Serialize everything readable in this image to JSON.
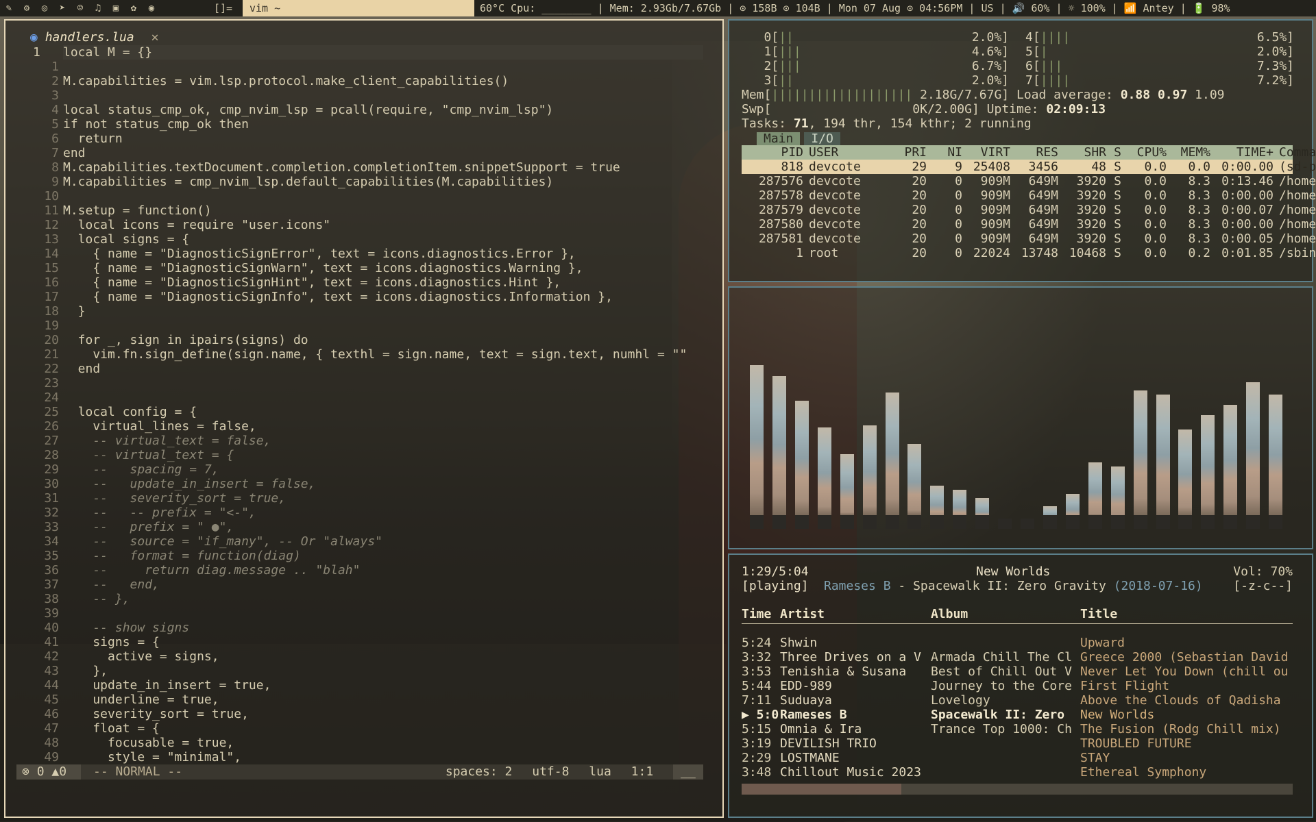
{
  "topbar": {
    "icons": [
      "paperclip-icon",
      "settings-icon",
      "browser-icon",
      "telegram-icon",
      "discord-icon",
      "music-icon",
      "screen-icon",
      "spotify-icon",
      "gamepad-icon"
    ],
    "layout": "[]=",
    "title": "vim ~",
    "status": "60°C Cpu: ________  |  Mem: 2.93Gb/7.67Gb  |  ⊙ 158B  ⊙ 104B  |  Mon 07 Aug  ⊙ 04:56PM  |  US  |  🔊 60%  |  ☼ 100%  |  📶 Antey  |  🔋 98%"
  },
  "vim": {
    "tab_name": "handlers.lua",
    "lines": [
      {
        "n": "1",
        "t": "local M = {}",
        "cur": true
      },
      {
        "n": "1",
        "t": ""
      },
      {
        "n": "2",
        "t": "M.capabilities = vim.lsp.protocol.make_client_capabilities()"
      },
      {
        "n": "3",
        "t": ""
      },
      {
        "n": "4",
        "t": "local status_cmp_ok, cmp_nvim_lsp = pcall(require, \"cmp_nvim_lsp\")"
      },
      {
        "n": "5",
        "t": "if not status_cmp_ok then"
      },
      {
        "n": "6",
        "t": "  return"
      },
      {
        "n": "7",
        "t": "end"
      },
      {
        "n": "8",
        "t": "M.capabilities.textDocument.completion.completionItem.snippetSupport = true"
      },
      {
        "n": "9",
        "t": "M.capabilities = cmp_nvim_lsp.default_capabilities(M.capabilities)"
      },
      {
        "n": "10",
        "t": ""
      },
      {
        "n": "11",
        "t": "M.setup = function()"
      },
      {
        "n": "12",
        "t": "  local icons = require \"user.icons\""
      },
      {
        "n": "13",
        "t": "  local signs = {"
      },
      {
        "n": "14",
        "t": "    { name = \"DiagnosticSignError\", text = icons.diagnostics.Error },"
      },
      {
        "n": "15",
        "t": "    { name = \"DiagnosticSignWarn\", text = icons.diagnostics.Warning },"
      },
      {
        "n": "16",
        "t": "    { name = \"DiagnosticSignHint\", text = icons.diagnostics.Hint },"
      },
      {
        "n": "17",
        "t": "    { name = \"DiagnosticSignInfo\", text = icons.diagnostics.Information },"
      },
      {
        "n": "18",
        "t": "  }"
      },
      {
        "n": "19",
        "t": ""
      },
      {
        "n": "20",
        "t": "  for _, sign in ipairs(signs) do"
      },
      {
        "n": "21",
        "t": "    vim.fn.sign_define(sign.name, { texthl = sign.name, text = sign.text, numhl = \"\""
      },
      {
        "n": "22",
        "t": "  end"
      },
      {
        "n": "23",
        "t": ""
      },
      {
        "n": "24",
        "t": ""
      },
      {
        "n": "25",
        "t": "  local config = {"
      },
      {
        "n": "26",
        "t": "    virtual_lines = false,"
      },
      {
        "n": "27",
        "t": "    -- virtual_text = false,"
      },
      {
        "n": "28",
        "t": "    -- virtual_text = {"
      },
      {
        "n": "29",
        "t": "    --   spacing = 7,"
      },
      {
        "n": "30",
        "t": "    --   update_in_insert = false,"
      },
      {
        "n": "31",
        "t": "    --   severity_sort = true,"
      },
      {
        "n": "32",
        "t": "    --   -- prefix = \"<-\","
      },
      {
        "n": "33",
        "t": "    --   prefix = \" ●\","
      },
      {
        "n": "34",
        "t": "    --   source = \"if_many\", -- Or \"always\""
      },
      {
        "n": "35",
        "t": "    --   format = function(diag)"
      },
      {
        "n": "36",
        "t": "    --     return diag.message .. \"blah\""
      },
      {
        "n": "37",
        "t": "    --   end,"
      },
      {
        "n": "38",
        "t": "    -- },"
      },
      {
        "n": "39",
        "t": ""
      },
      {
        "n": "40",
        "t": "    -- show signs"
      },
      {
        "n": "41",
        "t": "    signs = {"
      },
      {
        "n": "42",
        "t": "      active = signs,"
      },
      {
        "n": "43",
        "t": "    },"
      },
      {
        "n": "44",
        "t": "    update_in_insert = true,"
      },
      {
        "n": "45",
        "t": "    underline = true,"
      },
      {
        "n": "46",
        "t": "    severity_sort = true,"
      },
      {
        "n": "47",
        "t": "    float = {"
      },
      {
        "n": "48",
        "t": "      focusable = true,"
      },
      {
        "n": "49",
        "t": "      style = \"minimal\","
      }
    ],
    "status": {
      "errors": "0",
      "warnings": "0",
      "mode": "-- NORMAL --",
      "indent": "spaces: 2",
      "encoding": "utf-8",
      "filetype": "lua",
      "position": "1:1",
      "end": "__"
    }
  },
  "htop": {
    "cpus": [
      {
        "id": "0",
        "bars": "||",
        "pct": "2.0%]"
      },
      {
        "id": "1",
        "bars": "|||",
        "pct": "4.6%]"
      },
      {
        "id": "2",
        "bars": "|||",
        "pct": "6.7%]"
      },
      {
        "id": "3",
        "bars": "||",
        "pct": "2.0%]"
      },
      {
        "id": "4",
        "bars": "||||",
        "pct": "6.5%]"
      },
      {
        "id": "5",
        "bars": "|",
        "pct": "2.0%]"
      },
      {
        "id": "6",
        "bars": "|||",
        "pct": "7.3%]"
      },
      {
        "id": "7",
        "bars": "||||",
        "pct": "7.2%]"
      }
    ],
    "mem_label": "Mem[",
    "mem_bars": "|||||||||||||||||||",
    "mem_value": "2.18G/7.67G]",
    "swp_label": "Swp[",
    "swp_value": "0K/2.00G]",
    "load_label": "Load average:",
    "load_1": "0.88",
    "load_5": "0.97",
    "load_15": "1.09",
    "uptime_label": "Uptime:",
    "uptime": "02:09:13",
    "tasks_label": "Tasks:",
    "tasks": "71",
    "tasks_rest": ", 194 thr, 154 kthr; 2 running",
    "tabs": [
      "Main",
      "I/O"
    ],
    "columns": [
      "PID",
      "USER",
      "PRI",
      "NI",
      "VIRT",
      "RES",
      "SHR",
      "S",
      "CPU%",
      "MEM%",
      "TIME+",
      "Comman"
    ],
    "processes": [
      [
        "818",
        "devcote",
        "29",
        "9",
        "25408",
        "3456",
        "48",
        "S",
        "0.0",
        "0.0",
        "0:00.00",
        "(sd-pa"
      ],
      [
        "287576",
        "devcote",
        "20",
        "0",
        "909M",
        "649M",
        "3920",
        "S",
        "0.0",
        "8.3",
        "0:13.46",
        "/home/"
      ],
      [
        "287578",
        "devcote",
        "20",
        "0",
        "909M",
        "649M",
        "3920",
        "S",
        "0.0",
        "8.3",
        "0:00.00",
        "/home/"
      ],
      [
        "287579",
        "devcote",
        "20",
        "0",
        "909M",
        "649M",
        "3920",
        "S",
        "0.0",
        "8.3",
        "0:00.07",
        "/home/"
      ],
      [
        "287580",
        "devcote",
        "20",
        "0",
        "909M",
        "649M",
        "3920",
        "S",
        "0.0",
        "8.3",
        "0:00.00",
        "/home/"
      ],
      [
        "287581",
        "devcote",
        "20",
        "0",
        "909M",
        "649M",
        "3920",
        "S",
        "0.0",
        "8.3",
        "0:00.05",
        "/home/"
      ],
      [
        "1",
        "root",
        "20",
        "0",
        "22024",
        "13748",
        "10468",
        "S",
        "0.0",
        "0.2",
        "0:01.85",
        "/sbin/"
      ]
    ]
  },
  "cava": {
    "levels": [
      0.79,
      0.74,
      0.62,
      0.49,
      0.36,
      0.5,
      0.66,
      0.41,
      0.21,
      0.19,
      0.15,
      0.05,
      0.05,
      0.11,
      0.17,
      0.32,
      0.3,
      0.67,
      0.65,
      0.48,
      0.55,
      0.6,
      0.71,
      0.65
    ]
  },
  "ncmpcpp": {
    "time": "1:29/5:04",
    "song": "New Worlds",
    "volume": "Vol: 70%",
    "state": "[playing]",
    "artist": "Rameses B",
    "sep": " - ",
    "album": "Spacewalk II: Zero Gravity",
    "date": "(2018-07-16)",
    "flags": "[-z-c--]",
    "columns": {
      "time": "Time",
      "artist": "Artist",
      "album": "Album",
      "title": "Title"
    },
    "tracks": [
      {
        "time": "5:24",
        "artist": "Shwin",
        "album": "",
        "title": "Upward"
      },
      {
        "time": "3:32",
        "artist": "Three Drives on a V",
        "album": "Armada Chill The Cl",
        "title": "Greece 2000 (Sebastian David"
      },
      {
        "time": "3:53",
        "artist": "Tenishia & Susana",
        "album": "Best of Chill Out V",
        "title": "Never Let You Down (chill ou"
      },
      {
        "time": "5:44",
        "artist": "EDD-989",
        "album": "Journey to the Core",
        "title": "First Flight"
      },
      {
        "time": "7:11",
        "artist": "Suduaya",
        "album": "Lovelogy",
        "title": "Above the Clouds of Qadisha"
      },
      {
        "time": "▶ 5:0",
        "artist": "Rameses B",
        "album": "Spacewalk II: Zero",
        "title": "New Worlds",
        "playing": true
      },
      {
        "time": "5:15",
        "artist": "Omnia & Ira",
        "album": "Trance Top 1000: Ch",
        "title": "The Fusion (Rodg Chill mix)"
      },
      {
        "time": "3:19",
        "artist": "DEVILISH TRIO",
        "album": "",
        "title": "TROUBLED FUTURE"
      },
      {
        "time": "2:29",
        "artist": "LOSTMANE",
        "album": "",
        "title": "STAY"
      },
      {
        "time": "3:48",
        "artist": "Chillout Music 2023",
        "album": "",
        "title": "Ethereal Symphony"
      }
    ],
    "progress": 0.29
  }
}
